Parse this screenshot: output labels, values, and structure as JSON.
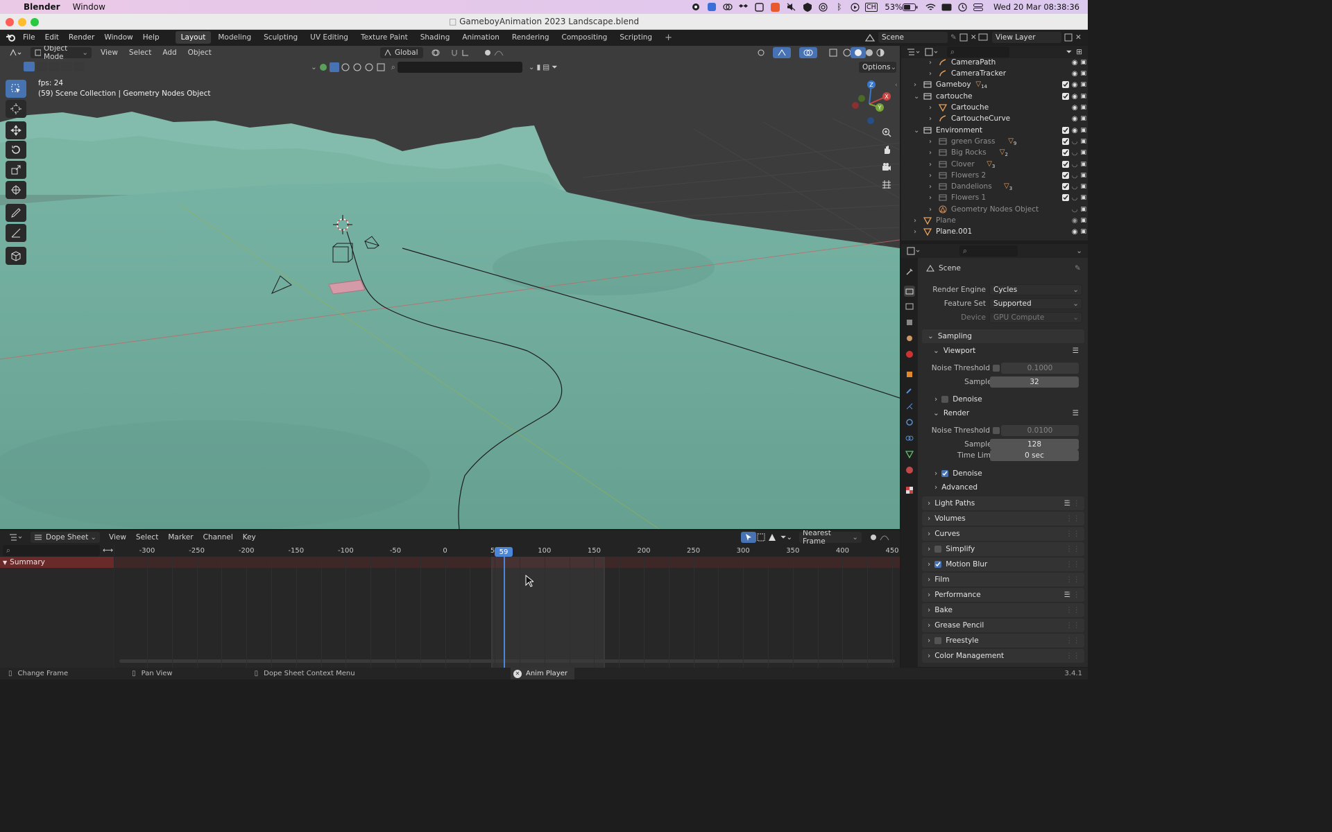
{
  "macos": {
    "app": "Blender",
    "menus": [
      "Window"
    ],
    "battery": "53%",
    "keyboard": "CH",
    "clock": "Wed 20 Mar  08:38:36"
  },
  "window": {
    "title": "GameboyAnimation 2023 Landscape.blend"
  },
  "topbar": {
    "menus": [
      "File",
      "Edit",
      "Render",
      "Window",
      "Help"
    ],
    "workspaces": [
      "Layout",
      "Modeling",
      "Sculpting",
      "UV Editing",
      "Texture Paint",
      "Shading",
      "Animation",
      "Rendering",
      "Compositing",
      "Scripting"
    ],
    "active_workspace": "Layout",
    "scene": "Scene",
    "view_layer": "View Layer"
  },
  "viewport": {
    "mode": "Object Mode",
    "menus": [
      "View",
      "Select",
      "Add",
      "Object"
    ],
    "transform_orientation": "Global",
    "options": "Options",
    "overlay_fps": "fps: 24",
    "overlay_info": "(59) Scene Collection | Geometry Nodes Object",
    "axis_labels": {
      "x": "X",
      "y": "Y",
      "z": "Z"
    },
    "colors": {
      "ground": "#6aa596",
      "sky": "#3c3c3c",
      "x_axis": "#b84848",
      "y_axis": "#7aa53a"
    }
  },
  "outliner": {
    "rows": [
      {
        "name": "CameraPath",
        "dim": false
      },
      {
        "name": "CameraTracker",
        "dim": false
      },
      {
        "name": "Gameboy",
        "dim": false,
        "badge": "14"
      },
      {
        "name": "cartouche",
        "dim": false
      },
      {
        "name": "Cartouche",
        "dim": false
      },
      {
        "name": "CartoucheCurve",
        "dim": false
      },
      {
        "name": "Environment",
        "dim": false
      },
      {
        "name": "green Grass",
        "dim": true,
        "badge": "9"
      },
      {
        "name": "Big Rocks",
        "dim": true,
        "badge": "2"
      },
      {
        "name": "Clover",
        "dim": true,
        "badge": "3"
      },
      {
        "name": "Flowers 2",
        "dim": true
      },
      {
        "name": "Dandelions",
        "dim": true,
        "badge": "3"
      },
      {
        "name": "Flowers 1",
        "dim": true
      },
      {
        "name": "Geometry Nodes Object",
        "dim": true
      },
      {
        "name": "Plane",
        "dim": true
      },
      {
        "name": "Plane.001",
        "dim": false
      }
    ]
  },
  "properties": {
    "context": "Scene",
    "render_engine_label": "Render Engine",
    "render_engine": "Cycles",
    "feature_set_label": "Feature Set",
    "feature_set": "Supported",
    "device_label": "Device",
    "device": "GPU Compute",
    "sampling": "Sampling",
    "viewport": "Viewport",
    "noise_threshold_label": "Noise Threshold",
    "viewport_noise_threshold": "0.1000",
    "samples_label": "Samples",
    "viewport_samples": "32",
    "denoise": "Denoise",
    "render": "Render",
    "render_noise_threshold": "0.0100",
    "render_samples": "128",
    "time_limit_label": "Time Limit",
    "time_limit": "0 sec",
    "advanced": "Advanced",
    "panels": [
      "Light Paths",
      "Volumes",
      "Curves",
      "Simplify",
      "Motion Blur",
      "Film",
      "Performance",
      "Bake",
      "Grease Pencil",
      "Freestyle",
      "Color Management"
    ]
  },
  "dopesheet": {
    "mode": "Dope Sheet",
    "menus": [
      "View",
      "Select",
      "Marker",
      "Channel",
      "Key"
    ],
    "snapping": "Nearest Frame",
    "ticks": [
      "-300",
      "-250",
      "-200",
      "-150",
      "-100",
      "-50",
      "0",
      "50",
      "100",
      "150",
      "200",
      "250",
      "300",
      "350",
      "400",
      "450"
    ],
    "current_frame": "59",
    "summary": "Summary"
  },
  "statusbar": {
    "items": [
      "Change Frame",
      "Pan View",
      "Dope Sheet Context Menu"
    ],
    "center": "Anim Player",
    "version": "3.4.1"
  }
}
